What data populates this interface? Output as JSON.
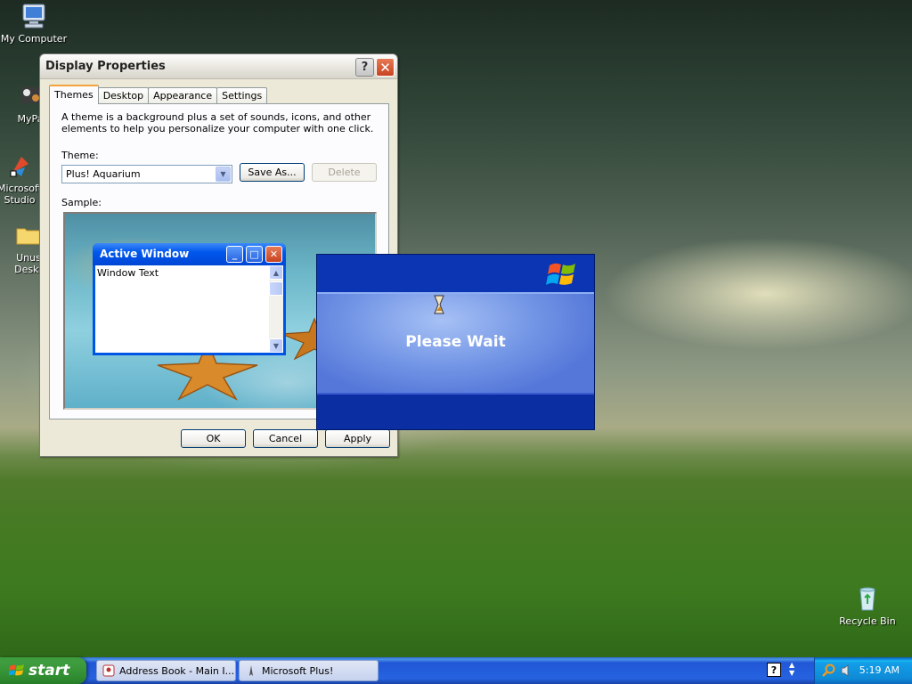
{
  "desktop": {
    "icons": [
      {
        "label": "My Computer",
        "icon": "my-computer-icon"
      },
      {
        "label": "MyPa",
        "icon": "my-pa-icon"
      },
      {
        "label": "Microsoft",
        "label2": "Studio",
        "icon": "microsoft-studio-icon"
      },
      {
        "label": "Unus",
        "label2": "Deskt",
        "icon": "folder-icon"
      },
      {
        "label": "Recycle Bin",
        "icon": "recycle-bin-icon"
      }
    ]
  },
  "dialog": {
    "title": "Display Properties",
    "help_button": "?",
    "close_button": "✕",
    "tabs": [
      {
        "label": "Themes",
        "active": true
      },
      {
        "label": "Desktop"
      },
      {
        "label": "Appearance"
      },
      {
        "label": "Settings"
      }
    ],
    "description": "A theme is a background plus a set of sounds, icons, and other elements to help you personalize your computer with one click.",
    "theme_label": "Theme:",
    "theme_value": "Plus! Aquarium",
    "save_as": "Save As...",
    "delete": "Delete",
    "sample_label": "Sample:",
    "sample_window": {
      "title": "Active Window",
      "text": "Window Text"
    },
    "ok": "OK",
    "cancel": "Cancel",
    "apply": "Apply"
  },
  "splash": {
    "message": "Please Wait",
    "logo": "windows-xp-logo"
  },
  "taskbar": {
    "start_label": "start",
    "tasks": [
      {
        "label": "Address Book - Main I...",
        "icon": "address-book-icon"
      },
      {
        "label": "Microsoft Plus!",
        "icon": "microsoft-plus-icon"
      }
    ],
    "clock": "5:19 AM"
  },
  "colors": {
    "xp_blue": "#0054e3",
    "start_green": "#3c9d3c",
    "splash_blue": "#0b35b3",
    "tab_highlight": "#f3a33b"
  }
}
